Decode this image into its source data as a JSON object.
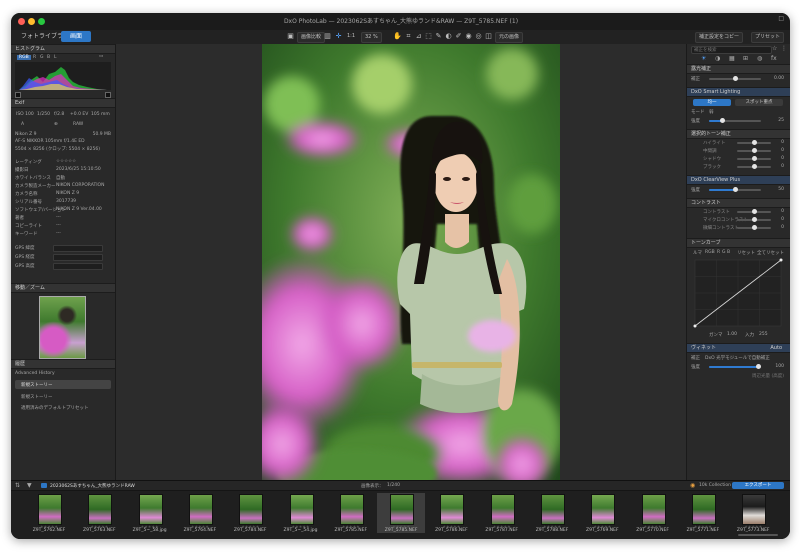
{
  "window": {
    "title": "DxO PhotoLab — 2023062Sあすちゃん_大熊ゆランド&RAW — Z9T_5785.NEF (1)",
    "right_controls": "□"
  },
  "toolbar": {
    "tab_library": "フォトライブラリ",
    "tab_customize": "画面",
    "display_btn": "画像比較",
    "zoom_fit": "1:1",
    "zoom_value": "32 %",
    "compare_btn": "比較",
    "before_after_btn": "元の画像",
    "copy_btn": "補正設定をコピー",
    "preset_btn": "プリセット"
  },
  "left_panel": {
    "histogram_title": "ヒストグラム",
    "histogram_tabs": [
      "RGB",
      "R",
      "G",
      "B",
      "L"
    ],
    "exif_title": "Exif",
    "exif_values": [
      "ISO 100",
      "1/250",
      "f/2.8",
      "+0.0 EV",
      "105 mm"
    ],
    "exif_icons": [
      "A",
      "⊕",
      "RAW"
    ],
    "camera": "Nikon Z 9",
    "file_size": "50.9 MB",
    "lens": "AF-S NIKKOR 105mm f/1.4E ED",
    "dimensions": "5504 × 8256 (クロップ: 5504 × 8256)",
    "meta_rows": [
      {
        "label": "レーティング",
        "value": "☆☆☆☆☆"
      },
      {
        "label": "撮影日",
        "value": "2023/6/25 15:10:50"
      },
      {
        "label": "ホワイトバランス",
        "value": "自動"
      },
      {
        "label": "カメラ製造メーカー",
        "value": "NIKON CORPORATION"
      },
      {
        "label": "カメラ名称",
        "value": "NIKON Z 9"
      },
      {
        "label": "シリアル番号",
        "value": "3017739"
      },
      {
        "label": "ソフトウェア/バージョン",
        "value": "NIKON Z 9 Ver.04.00"
      },
      {
        "label": "著者",
        "value": "---"
      },
      {
        "label": "コピーライト",
        "value": "---"
      },
      {
        "label": "キーワード",
        "value": "---"
      }
    ],
    "gps_rows": [
      "GPS 緯度",
      "GPS 経度",
      "GPS 高度"
    ],
    "nav_title": "移動／ズーム",
    "history_title": "履歴",
    "history_root": "Advanced History",
    "history_items": [
      "新規ストーリー",
      "新規ストーリー",
      "適用済みのデフォルトプリセット"
    ]
  },
  "right_panel": {
    "search_placeholder": "補正を検索",
    "section1_title": "露光補正",
    "exposure_label": "補正",
    "exposure_value": "0.00",
    "smart_lighting_title": "DxO Smart Lighting",
    "smart_modes": [
      "均一",
      "スポット重点"
    ],
    "mode_label": "モード",
    "mode_value": "弱",
    "intensity_label": "強度",
    "intensity_value": "25",
    "tone_title": "選択的トーン補正",
    "tone_rows": [
      {
        "label": "ハイライト",
        "value": "0"
      },
      {
        "label": "中間調",
        "value": "0"
      },
      {
        "label": "シャドウ",
        "value": "0"
      },
      {
        "label": "ブラック",
        "value": "0"
      }
    ],
    "clearview_title": "DxO ClearView Plus",
    "clearview_label": "強度",
    "clearview_value": "50",
    "contrast_title": "コントラスト",
    "contrast_rows": [
      {
        "label": "コントラスト",
        "value": "0"
      },
      {
        "label": "マイクロコントラスト",
        "value": "0"
      },
      {
        "label": "微細コントラスト",
        "value": "0"
      }
    ],
    "tone_curve_title": "トーンカーブ",
    "curve_tabs": [
      "ルマ",
      "RGB",
      "R",
      "G",
      "B"
    ],
    "curve_reset": "リセット",
    "curve_preset": "全てリセット",
    "gamma_label": "ガンマ",
    "gamma_value": "1.00",
    "input_label": "入力",
    "input_value": "255",
    "vignette_title": "ヴィネット",
    "vignette_auto": "Auto",
    "vignette_mode_label": "補正",
    "vignette_mode_value": "DxO 光学モジュールで自動補正",
    "vignette_intensity_label": "強度",
    "vignette_intensity_value": "100",
    "vignette_footer": "周辺光量 (高度)"
  },
  "filmstrip": {
    "folder": "2023062Sあすちゃん_大熊ゆランドRAW",
    "count_label": "画像表示：",
    "count_value": "1/240",
    "collection_btn": "10k Collection",
    "export_btn": "エクスポート",
    "thumbs": [
      "Z9T_5762.NEF",
      "Z9T_5763.NEF",
      "Z9T_5~_58.jpg",
      "Z9T_5764.NEF",
      "Z9T_5784.NEF",
      "Z9T_5~_54.jpg",
      "Z9T_5785.NEF",
      "Z9T_5785.NEF",
      "Z9T_5786.NEF",
      "Z9T_5787.NEF",
      "Z9T_5788.NEF",
      "Z9T_5769.NEF",
      "Z9T_5770.NEF",
      "Z9T_5771.NEF",
      "Z9T_5773.NEF"
    ],
    "selected_index": 7
  },
  "colors": {
    "accent": "#2d77c6",
    "panel": "#292929",
    "viewer": "#2c2c2c"
  }
}
